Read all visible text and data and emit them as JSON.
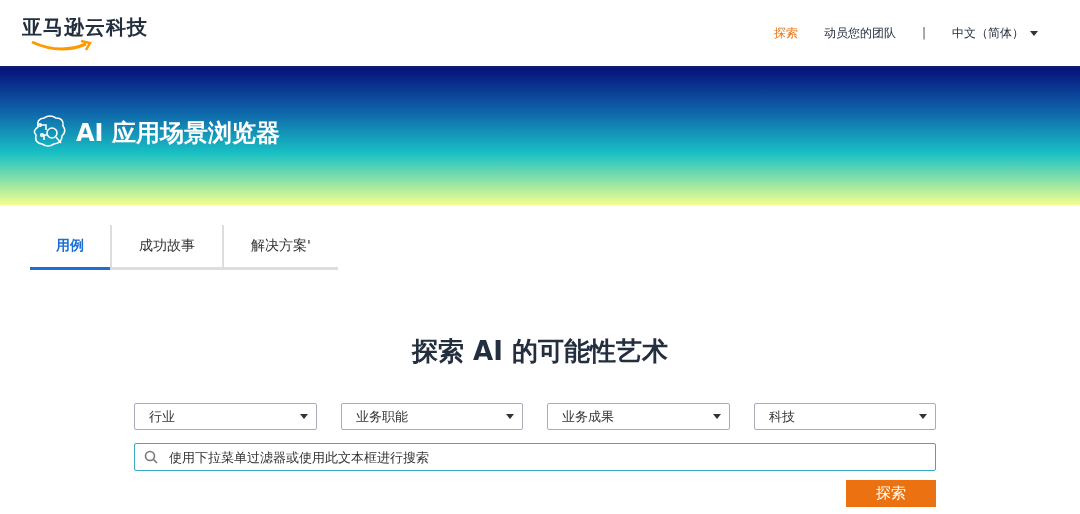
{
  "header": {
    "logo": "亚马逊云科技",
    "nav": [
      {
        "label": "探索",
        "selected": true
      },
      {
        "label": "动员您的团队",
        "selected": false
      }
    ],
    "separator": "|",
    "language": "中文（简体）"
  },
  "banner": {
    "title": "AI 应用场景浏览器"
  },
  "tabs": [
    {
      "label": "用例",
      "selected": true
    },
    {
      "label": "成功故事",
      "selected": false
    },
    {
      "label": "解决方案'",
      "selected": false
    }
  ],
  "heading": "探索 AI 的可能性艺术",
  "filters": [
    "行业",
    "业务职能",
    "业务成果",
    "科技"
  ],
  "search": {
    "placeholder": "使用下拉菜单过滤器或使用此文本框进行搜索"
  },
  "search_button": "探索"
}
